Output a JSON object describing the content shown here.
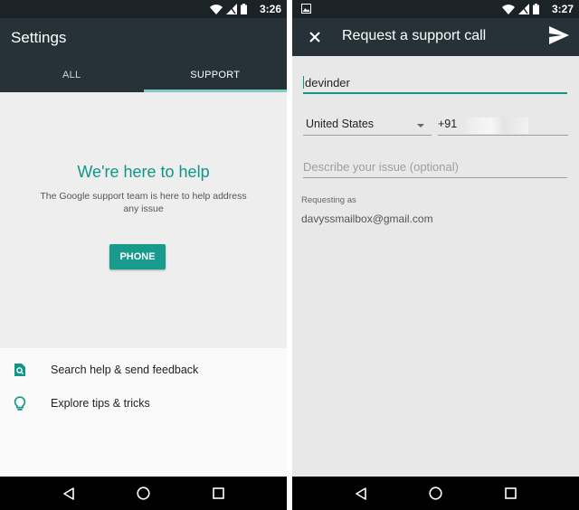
{
  "left_screen": {
    "status": {
      "time": "3:26"
    },
    "title": "Settings",
    "tabs": [
      {
        "label": "ALL",
        "selected": false
      },
      {
        "label": "SUPPORT",
        "selected": true
      }
    ],
    "support": {
      "heading": "We're here to help",
      "description": "The Google support team is here to help address any issue",
      "phone_button": "PHONE"
    },
    "list": [
      {
        "label": "Search help & send feedback",
        "icon": "search-document-icon"
      },
      {
        "label": "Explore tips & tricks",
        "icon": "lightbulb-icon"
      }
    ]
  },
  "right_screen": {
    "status": {
      "time": "3:27"
    },
    "title": "Request a support call",
    "form": {
      "name_value": "devinder",
      "country_value": "United States",
      "phone_prefix": "+91",
      "issue_placeholder": "Describe your issue (optional)",
      "requesting_label": "Requesting as",
      "email": "davyssmailbox@gmail.com"
    }
  },
  "colors": {
    "accent": "#109688",
    "appbar": "#263238",
    "statusbar": "#1c2327",
    "tab_indicator": "#80cbc4"
  }
}
